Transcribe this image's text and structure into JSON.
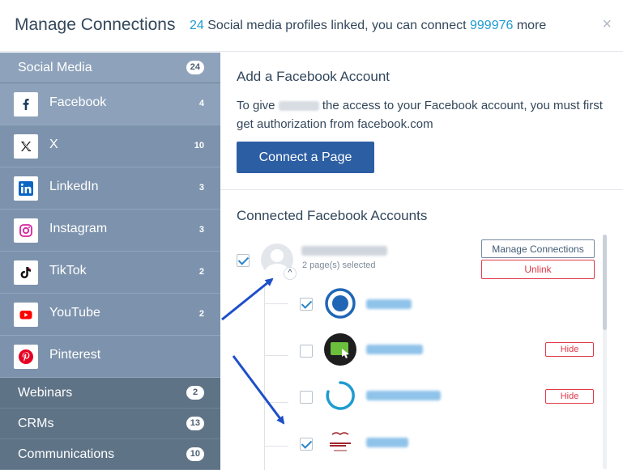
{
  "header": {
    "title": "Manage Connections",
    "count": "24",
    "text_mid": "Social media profiles linked, you can connect",
    "remaining": "999976",
    "text_end": "more",
    "close_icon": "×"
  },
  "sidebar": {
    "social": {
      "label": "Social Media",
      "count": "24"
    },
    "items": [
      {
        "label": "Facebook",
        "count": "4",
        "icon": "facebook-icon"
      },
      {
        "label": "X",
        "count": "10",
        "icon": "x-icon"
      },
      {
        "label": "LinkedIn",
        "count": "3",
        "icon": "linkedin-icon"
      },
      {
        "label": "Instagram",
        "count": "3",
        "icon": "instagram-icon"
      },
      {
        "label": "TikTok",
        "count": "2",
        "icon": "tiktok-icon"
      },
      {
        "label": "YouTube",
        "count": "2",
        "icon": "youtube-icon"
      },
      {
        "label": "Pinterest",
        "count": "",
        "icon": "pinterest-icon"
      }
    ],
    "categories": [
      {
        "label": "Webinars",
        "count": "2"
      },
      {
        "label": "CRMs",
        "count": "13"
      },
      {
        "label": "Communications",
        "count": "10"
      }
    ]
  },
  "add": {
    "title": "Add a Facebook Account",
    "desc_pre": "To give",
    "desc_post": "the access to your Facebook account, you must first get authorization from facebook.com",
    "connect_label": "Connect a Page"
  },
  "connected": {
    "title": "Connected Facebook Accounts",
    "pages_selected": "2 page(s) selected",
    "manage_label": "Manage Connections",
    "unlink_label": "Unlink",
    "hide_label": "Hide"
  },
  "colors": {
    "accent": "#1f9bd1",
    "primary_button": "#2c5ea3",
    "danger": "#e0394a",
    "sidebar": "#5f7387"
  }
}
